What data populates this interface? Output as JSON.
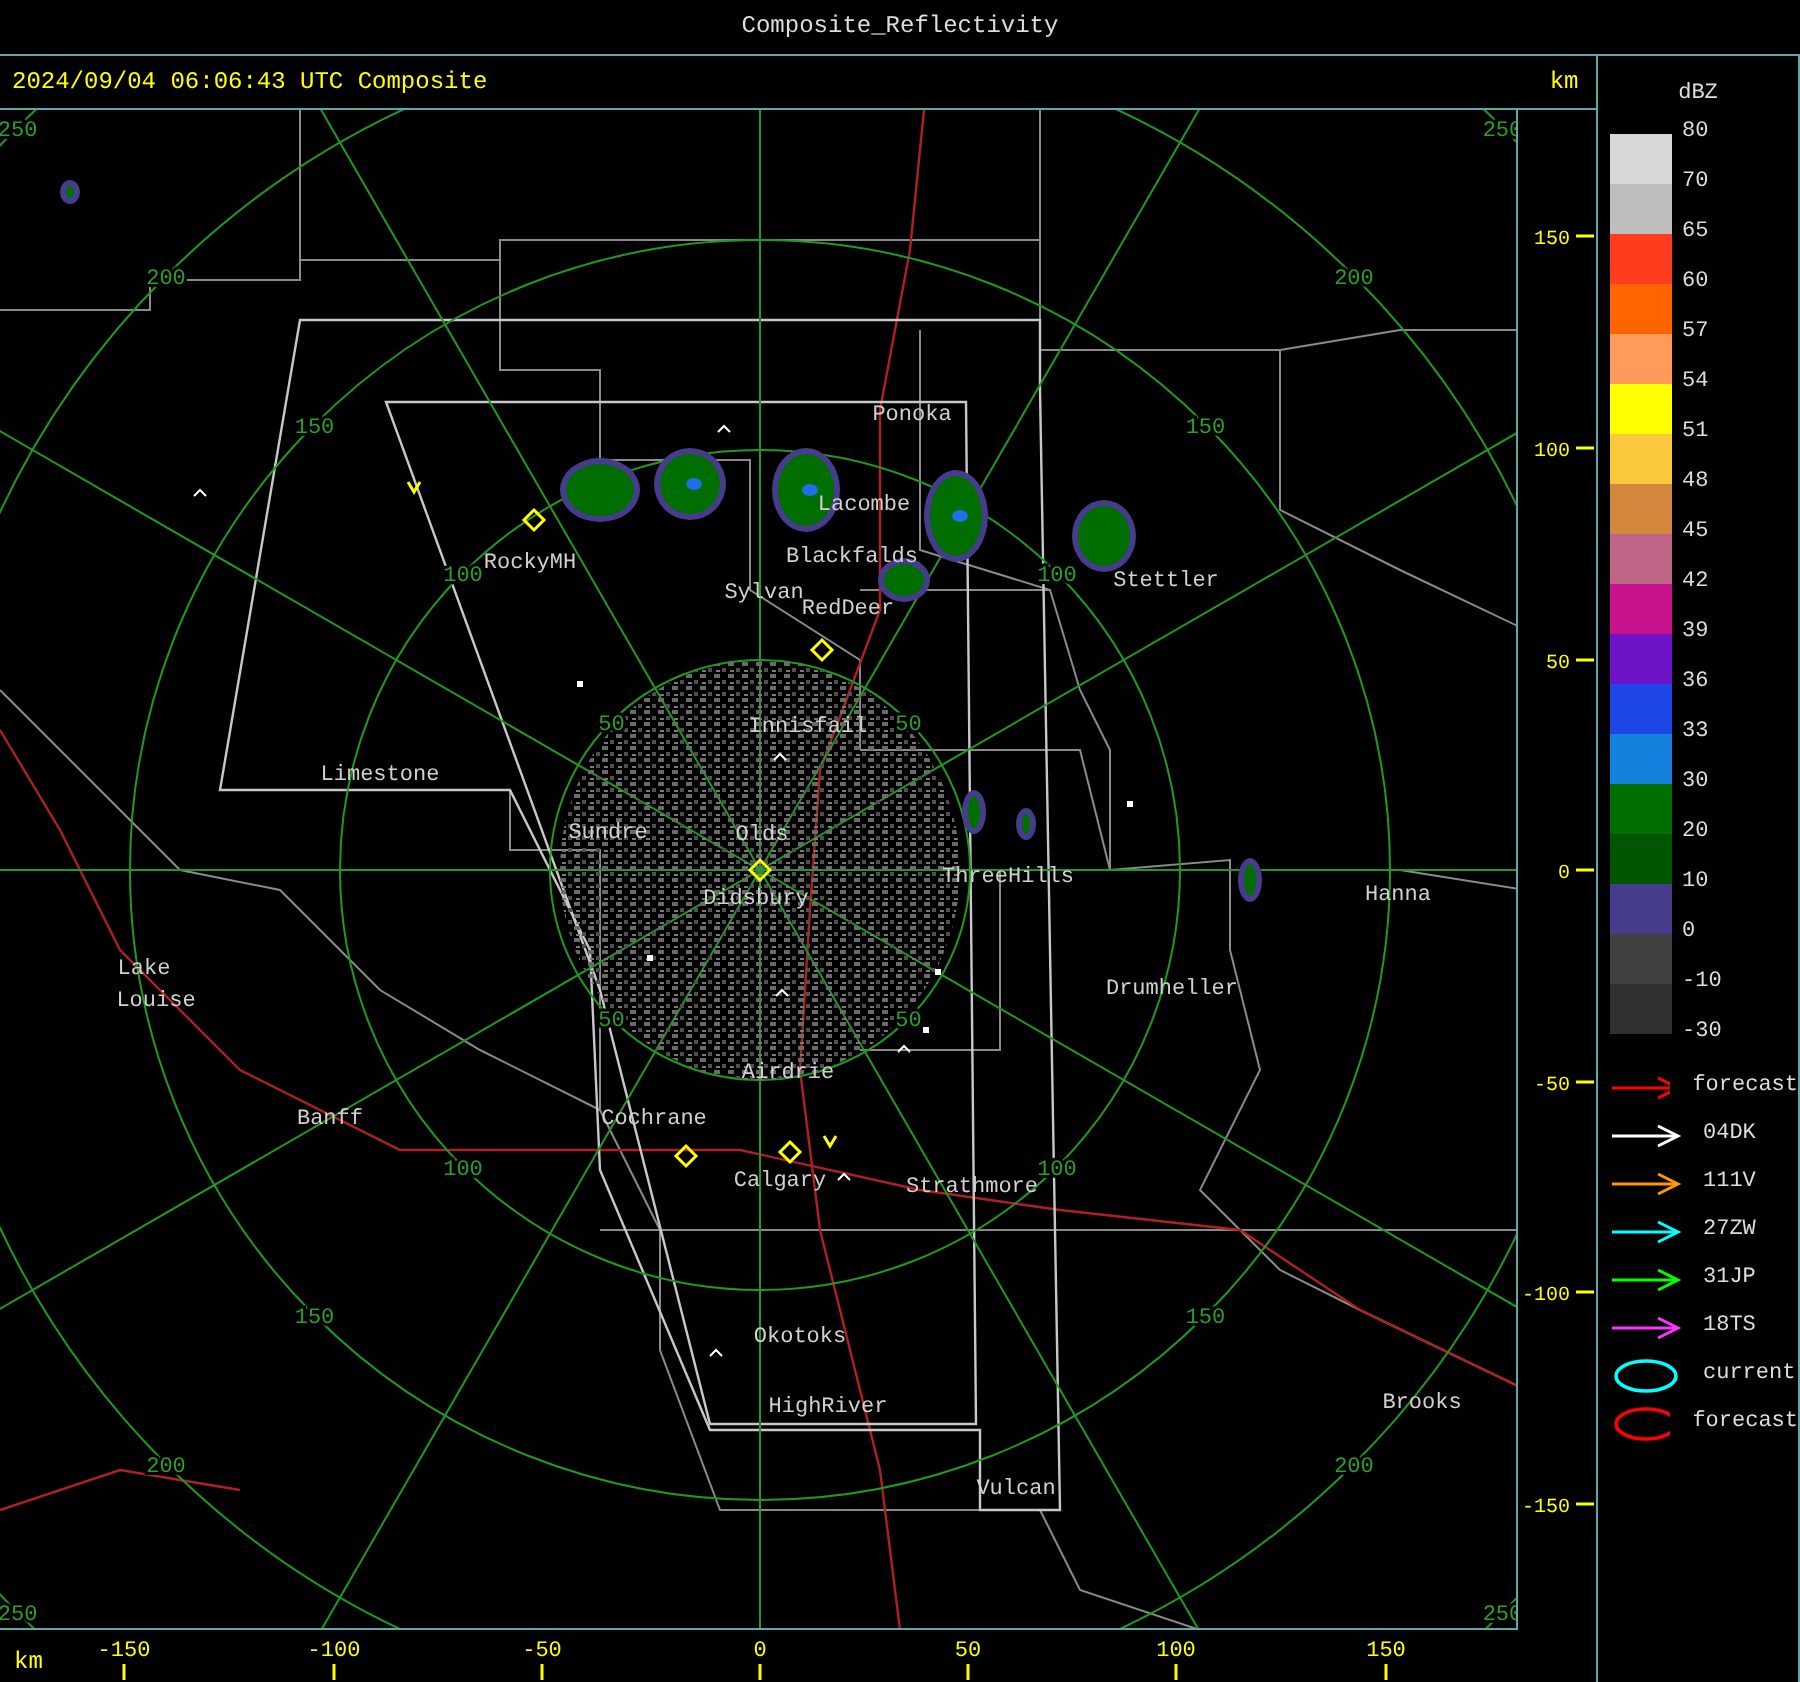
{
  "window": {
    "title": "Composite_Reflectivity"
  },
  "header": {
    "timestamp": "2024/09/04 06:06:43 UTC Composite",
    "unit": "km"
  },
  "map": {
    "range_rings": [
      {
        "labels": [
          "50",
          "50",
          "50",
          "50"
        ]
      },
      {
        "labels": [
          "100",
          "100",
          "100",
          "100"
        ]
      },
      {
        "labels": [
          "150",
          "150",
          "150",
          "150"
        ]
      },
      {
        "labels": [
          "200",
          "200",
          "200",
          "200"
        ]
      },
      {
        "labels": [
          "250",
          "250",
          "250",
          "250"
        ]
      }
    ],
    "places": [
      "Ponoka",
      "Lacombe",
      "Blackfalds",
      "RockyMH",
      "Sylvan",
      "RedDeer",
      "Stettler",
      "Innisfail",
      "Limestone",
      "Sundre",
      "Olds",
      "Didsbury",
      "ThreeHills",
      "Hanna",
      "Lake",
      "Louise",
      "Drumheller",
      "Airdrie",
      "Cochrane",
      "Banff",
      "Calgary",
      "Strathmore",
      "Okotoks",
      "HighRiver",
      "Vulcan",
      "Brooks"
    ]
  },
  "y_axis": {
    "labels": [
      "150",
      "100",
      "50",
      "0",
      "-50",
      "-100",
      "-150"
    ]
  },
  "x_axis": {
    "unit": "km",
    "labels": [
      "-150",
      "-100",
      "-50",
      "0",
      "50",
      "100",
      "150"
    ]
  },
  "legend": {
    "title": "dBZ",
    "scale_labels": [
      "80",
      "70",
      "65",
      "60",
      "57",
      "54",
      "51",
      "48",
      "45",
      "42",
      "39",
      "36",
      "33",
      "30",
      "20",
      "10",
      "0",
      "-10",
      "-30"
    ],
    "bins": [
      {
        "color": "#d8d8d8"
      },
      {
        "color": "#bebebe"
      },
      {
        "color": "#ff3c1e"
      },
      {
        "color": "#ff6400"
      },
      {
        "color": "#ff9a5a"
      },
      {
        "color": "#ffff00"
      },
      {
        "color": "#fac83c"
      },
      {
        "color": "#d2873c"
      },
      {
        "color": "#be6487"
      },
      {
        "color": "#c8148c"
      },
      {
        "color": "#6e14c8"
      },
      {
        "color": "#1e46e6"
      },
      {
        "color": "#1482dc"
      },
      {
        "color": "#006e00"
      },
      {
        "color": "#005500"
      },
      {
        "color": "#463c8c"
      },
      {
        "color": "#404040"
      },
      {
        "color": "#303030"
      }
    ],
    "tracks": [
      {
        "kind": "arrow",
        "color": "#ff0000",
        "label": "forecast"
      },
      {
        "kind": "arrow",
        "color": "#ffffff",
        "label": "04DK"
      },
      {
        "kind": "arrow",
        "color": "#ff9900",
        "label": "111V"
      },
      {
        "kind": "arrow",
        "color": "#00ffff",
        "label": "27ZW"
      },
      {
        "kind": "arrow",
        "color": "#00ff00",
        "label": "31JP"
      },
      {
        "kind": "arrow",
        "color": "#ff33ff",
        "label": "18TS"
      },
      {
        "kind": "ellipse",
        "color": "#00ffff",
        "label": "current"
      },
      {
        "kind": "ellipse",
        "color": "#ff0000",
        "label": "forecast"
      }
    ]
  }
}
